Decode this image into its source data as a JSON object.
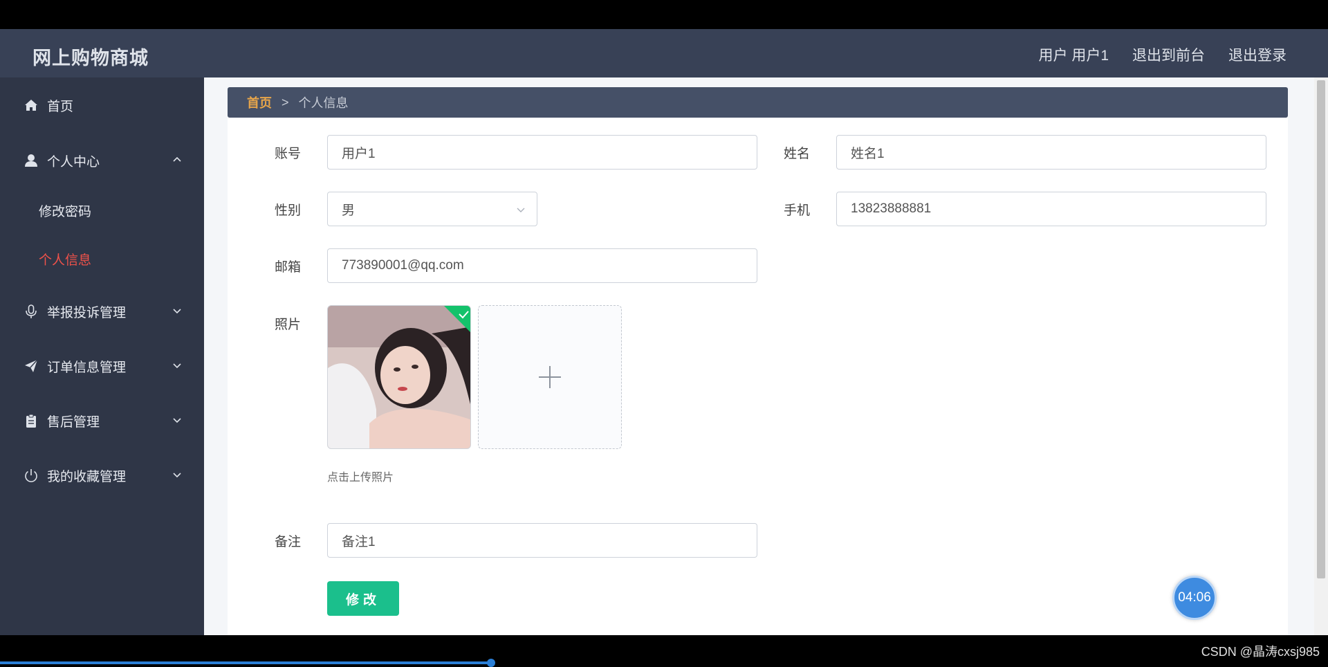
{
  "header": {
    "brand": "网上购物商城",
    "user_label": "用户 用户1",
    "exit_front": "退出到前台",
    "logout": "退出登录"
  },
  "sidebar": {
    "items": [
      {
        "label": "首页",
        "icon": "home-icon"
      },
      {
        "label": "个人中心",
        "icon": "user-icon"
      },
      {
        "label": "修改密码"
      },
      {
        "label": "个人信息"
      },
      {
        "label": "举报投诉管理",
        "icon": "microphone-icon"
      },
      {
        "label": "订单信息管理",
        "icon": "paper-plane-icon"
      },
      {
        "label": "售后管理",
        "icon": "clipboard-icon"
      },
      {
        "label": "我的收藏管理",
        "icon": "power-icon"
      }
    ]
  },
  "breadcrumb": {
    "home": "首页",
    "separator": ">",
    "current": "个人信息"
  },
  "form": {
    "account_label": "账号",
    "account_value": "用户1",
    "name_label": "姓名",
    "name_value": "姓名1",
    "gender_label": "性别",
    "gender_value": "男",
    "phone_label": "手机",
    "phone_value": "13823888881",
    "email_label": "邮箱",
    "email_value": "773890001@qq.com",
    "photo_label": "照片",
    "upload_hint": "点击上传照片",
    "remark_label": "备注",
    "remark_value": "备注1",
    "submit_label": "修改"
  },
  "overlay": {
    "timer": "04:06",
    "watermark": "CSDN @晶涛cxsj985",
    "progress_fraction": 0.37
  },
  "colors": {
    "header_bg": "#384156",
    "sidebar_bg": "#2f3647",
    "active_menu": "#f0524a",
    "breadcrumb_home": "#e9a64a",
    "submit_button": "#1bbf8c"
  }
}
